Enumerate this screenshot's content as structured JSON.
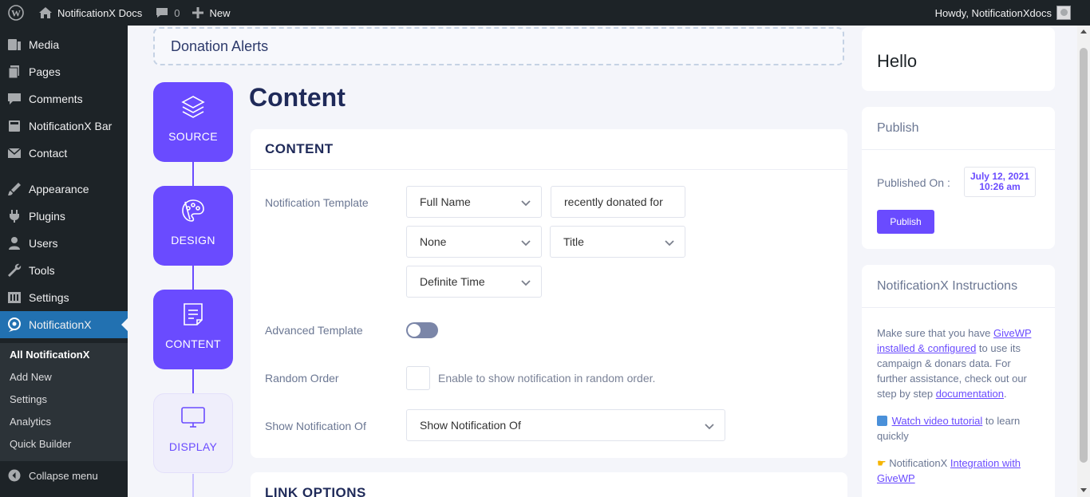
{
  "admin_bar": {
    "site_name": "NotificationX Docs",
    "comments_count": "0",
    "new_label": "New",
    "howdy": "Howdy, NotificationXdocs"
  },
  "sidebar": {
    "items": [
      {
        "label": "Media",
        "icon": "media-icon"
      },
      {
        "label": "Pages",
        "icon": "pages-icon"
      },
      {
        "label": "Comments",
        "icon": "comments-icon"
      },
      {
        "label": "NotificationX Bar",
        "icon": "bar-icon"
      },
      {
        "label": "Contact",
        "icon": "mail-icon"
      },
      {
        "label": "Appearance",
        "icon": "brush-icon"
      },
      {
        "label": "Plugins",
        "icon": "plugin-icon"
      },
      {
        "label": "Users",
        "icon": "users-icon"
      },
      {
        "label": "Tools",
        "icon": "wrench-icon"
      },
      {
        "label": "Settings",
        "icon": "settings-icon"
      },
      {
        "label": "NotificationX",
        "icon": "notificationx-icon"
      }
    ],
    "submenu": [
      "All NotificationX",
      "Add New",
      "Settings",
      "Analytics",
      "Quick Builder"
    ],
    "collapse_label": "Collapse menu"
  },
  "header": {
    "alert_title": "Donation Alerts"
  },
  "steps": [
    {
      "label": "SOURCE",
      "icon": "layers-icon",
      "active": true
    },
    {
      "label": "DESIGN",
      "icon": "palette-icon",
      "active": true
    },
    {
      "label": "CONTENT",
      "icon": "document-icon",
      "active": true
    },
    {
      "label": "DISPLAY",
      "icon": "monitor-icon",
      "active": false
    }
  ],
  "content": {
    "page_title": "Content",
    "card_title": "CONTENT",
    "notification_template_label": "Notification Template",
    "template_field_1": "Full Name",
    "template_text": "recently donated for",
    "template_field_2": "None",
    "template_field_3": "Title",
    "template_field_4": "Definite Time",
    "advanced_template_label": "Advanced Template",
    "random_order_label": "Random Order",
    "random_order_desc": "Enable to show notification in random order.",
    "show_notification_label": "Show Notification Of",
    "show_notification_value": "Show Notification Of",
    "link_options_title": "LINK OPTIONS"
  },
  "right": {
    "hello": "Hello",
    "publish_title": "Publish",
    "published_on_label": "Published On :",
    "published_date": "July 12, 2021",
    "published_time": "10:26 am",
    "publish_button": "Publish",
    "instructions_title": "NotificationX Instructions",
    "instr_p1_before": "Make sure that you have ",
    "instr_link_givewp": "GiveWP",
    "instr_link_installed": "installed & configured",
    "instr_p1_after": " to use its campaign & donars data. For further assistance, check out our step by step ",
    "instr_link_docs": "documentation",
    "instr_p1_end": ".",
    "instr_link_video": "Watch video tutorial",
    "instr_p2_after": " to learn quickly",
    "instr_p3_before": "NotificationX ",
    "instr_link_integration": "Integration with GiveWP"
  },
  "colors": {
    "accent": "#6a4bff",
    "wp_dark": "#1d2327",
    "wp_blue": "#2271b1"
  }
}
